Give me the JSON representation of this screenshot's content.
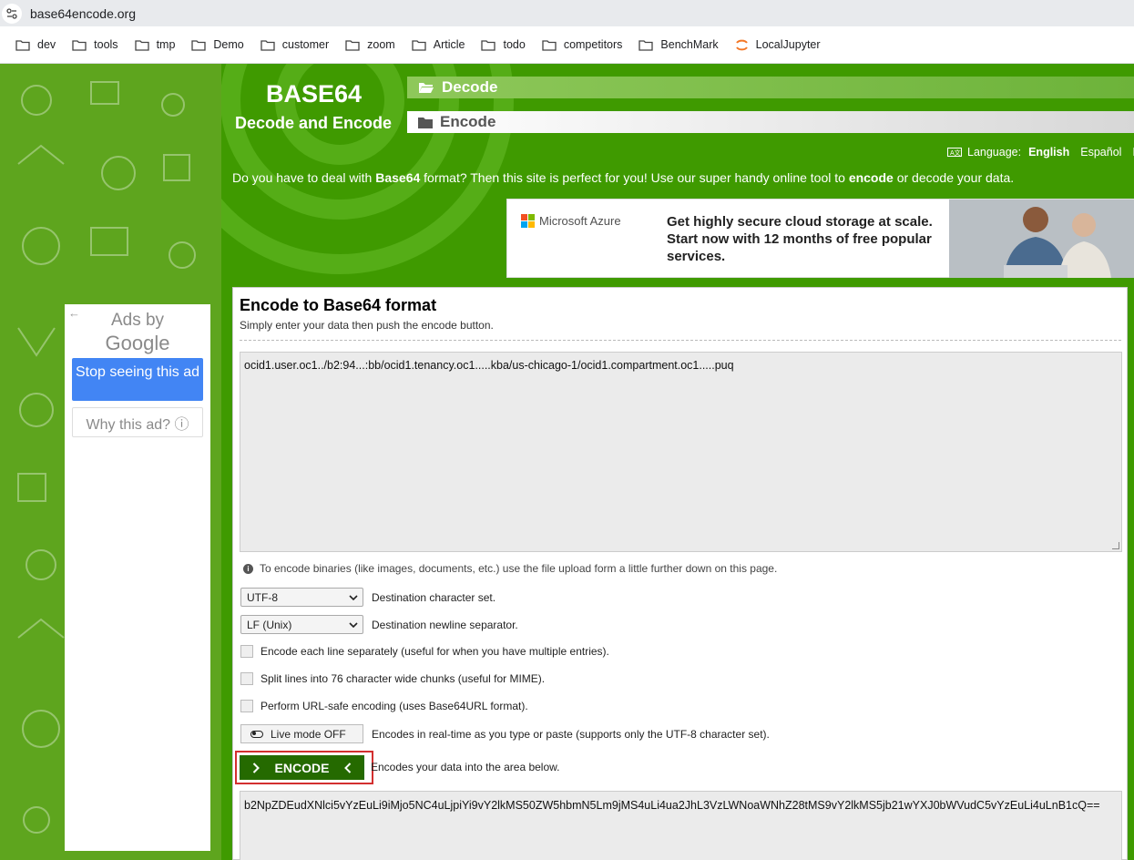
{
  "browser": {
    "url": "base64encode.org",
    "bookmarks": [
      "dev",
      "tools",
      "tmp",
      "Demo",
      "customer",
      "zoom",
      "Article",
      "todo",
      "competitors",
      "BenchMark",
      "LocalJupyter"
    ]
  },
  "header": {
    "logo_title": "BASE64",
    "logo_subtitle": "Decode and Encode",
    "nav_decode": "Decode",
    "nav_encode": "Encode",
    "language_label": "Language:",
    "languages": [
      "English",
      "Español",
      "F"
    ],
    "active_language": "English"
  },
  "intro": {
    "part1": "Do you have to deal with ",
    "bold1": "Base64",
    "part2": " format? Then this site is perfect for you! Use our super handy online tool to ",
    "bold2": "encode",
    "part3": " or decode your data."
  },
  "banner_ad": {
    "brand": "Microsoft Azure",
    "text": "Get highly secure cloud storage at scale. Start now with 12 months of free popular services."
  },
  "side_ad": {
    "back_arrow": "←",
    "ads_by": "Ads by",
    "google": "Google",
    "stop_label": "Stop seeing this ad",
    "why_label": "Why this ad? ⓘ"
  },
  "main": {
    "title": "Encode to Base64 format",
    "subtitle": "Simply enter your data then push the encode button.",
    "input_value": "ocid1.user.oc1../b2:94...:bb/ocid1.tenancy.oc1.....kba/us-chicago-1/ocid1.compartment.oc1.....puq",
    "binary_note": "To encode binaries (like images, documents, etc.) use the file upload form a little further down on this page.",
    "charset_value": "UTF-8",
    "charset_label": "Destination character set.",
    "newline_value": "LF (Unix)",
    "newline_label": "Destination newline separator.",
    "opt_each_line": "Encode each line separately (useful for when you have multiple entries).",
    "opt_split": "Split lines into 76 character wide chunks (useful for MIME).",
    "opt_urlsafe": "Perform URL-safe encoding (uses Base64URL format).",
    "live_mode_label": "Live mode OFF",
    "live_mode_desc": "Encodes in real-time as you type or paste (supports only the UTF-8 character set).",
    "encode_label": "ENCODE",
    "encode_desc": "Encodes your data into the area below.",
    "output_value": "b2NpZDEudXNlci5vYzEuLi9iMjo5NC4uLjpiYi9vY2lkMS50ZW5hbmN5Lm9jMS4uLi4ua2JhL3VzLWNoaWNhZ28tMS9vY2lkMS5jb21wYXJ0bWVudC5vYzEuLi4uLnB1cQ=="
  },
  "colors": {
    "page_green": "#5ea51e",
    "band_green": "#3f9a00",
    "encode_button": "#256a00",
    "highlight_red": "#d32f2f",
    "google_blue": "#4285f4"
  }
}
